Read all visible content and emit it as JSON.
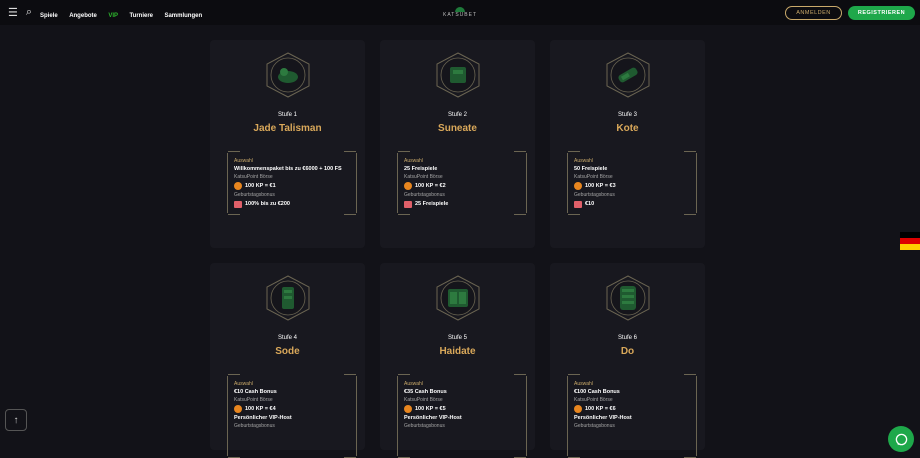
{
  "header": {
    "nav": [
      "Spiele",
      "Angebote",
      "VIP",
      "Turniere",
      "Sammlungen"
    ],
    "logo": "KATSUBET",
    "login": "ANMELDEN",
    "register": "REGISTRIEREN"
  },
  "colors": {
    "accent_green": "#1ea84a",
    "gold": "#d9a85a",
    "background": "#121218"
  },
  "tiers": [
    {
      "stufe": "Stufe 1",
      "name": "Jade Talisman",
      "reward_caption": "Auswahl",
      "reward": "Willkommenspaket bis zu €6000 + 100 FS",
      "points_caption": "KatsuPoint Börse",
      "points": "100 KP = €1",
      "birthday_caption": "Geburtstagsbonus",
      "birthday": "100% bis zu €200"
    },
    {
      "stufe": "Stufe 2",
      "name": "Suneate",
      "reward_caption": "Auswahl",
      "reward": "25 Freispiele",
      "points_caption": "KatsuPoint Börse",
      "points": "100 KP = €2",
      "birthday_caption": "Geburtstagsbonus",
      "birthday": "25 Freispiele"
    },
    {
      "stufe": "Stufe 3",
      "name": "Kote",
      "reward_caption": "Auswahl",
      "reward": "50 Freispiele",
      "points_caption": "KatsuPoint Börse",
      "points": "100 KP = €3",
      "birthday_caption": "Geburtstagsbonus",
      "birthday": "€10"
    },
    {
      "stufe": "Stufe 4",
      "name": "Sode",
      "reward_caption": "Auswahl",
      "reward": "€10 Cash Bonus",
      "points_caption": "KatsuPoint Börse",
      "points": "100 KP = €4",
      "extra": "Persönlicher VIP-Host",
      "birthday_caption": "Geburtstagsbonus"
    },
    {
      "stufe": "Stufe 5",
      "name": "Haidate",
      "reward_caption": "Auswahl",
      "reward": "€35 Cash Bonus",
      "points_caption": "KatsuPoint Börse",
      "points": "100 KP = €5",
      "extra": "Persönlicher VIP-Host",
      "birthday_caption": "Geburtstagsbonus"
    },
    {
      "stufe": "Stufe 6",
      "name": "Do",
      "reward_caption": "Auswahl",
      "reward": "€100 Cash Bonus",
      "points_caption": "KatsuPoint Börse",
      "points": "100 KP = €6",
      "extra": "Persönlicher VIP-Host",
      "birthday_caption": "Geburtstagsbonus"
    }
  ],
  "icons": {
    "menu": "menu-icon",
    "search": "search-icon",
    "emblem": "armor-emblem-icon",
    "coin": "coin-icon",
    "gift": "gift-icon",
    "flag": "german-flag-icon",
    "scroll_up": "arrow-up-icon",
    "chat": "chat-icon"
  }
}
